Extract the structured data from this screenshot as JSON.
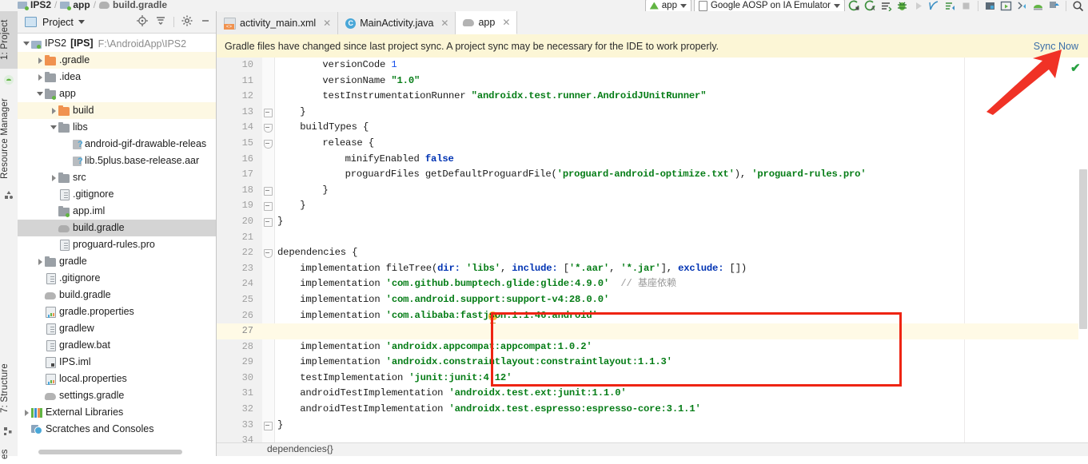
{
  "window": {
    "breadcrumb": [
      {
        "label": "IPS2",
        "icon": "module-icon",
        "type": "module"
      },
      {
        "label": "app",
        "icon": "module-icon",
        "type": "module"
      },
      {
        "label": "build.gradle",
        "icon": "gradle-icon",
        "type": "file"
      }
    ],
    "run_config": "app",
    "device": "Google AOSP on IA Emulator",
    "toolbar_icons": [
      "debug-step-icon",
      "debug-attach-icon",
      "logcat-icon",
      "bug-icon",
      "run-disabled-icon",
      "profiler-icon",
      "apply-changes-icon",
      "stop-icon",
      "avd-manager-icon",
      "run-button-icon",
      "sdk-sync-icon",
      "sdk-manager-icon",
      "download-icon",
      "search-icon"
    ]
  },
  "tool_strips": {
    "left": [
      {
        "label": "1: Project",
        "selected": true
      },
      {
        "label": "Resource Manager",
        "selected": false
      },
      {
        "label": "7: Structure",
        "selected": false
      },
      {
        "label": "es",
        "selected": false
      }
    ]
  },
  "project_panel": {
    "title": "Project",
    "tools": [
      "locate-icon",
      "collapse-all-icon",
      "settings-gear-icon",
      "hide-minimize-icon"
    ],
    "tree": [
      {
        "label": "IPS2",
        "tag": "[IPS]",
        "path": "F:\\AndroidApp\\IPS2",
        "indent": 0,
        "arrow": "open",
        "icon": "module-icon",
        "state": "normal"
      },
      {
        "label": ".gradle",
        "indent": 1,
        "arrow": "closed",
        "icon": "folder-orange-icon",
        "state": "highlight"
      },
      {
        "label": ".idea",
        "indent": 1,
        "arrow": "closed",
        "icon": "folder-gray-icon",
        "state": "normal"
      },
      {
        "label": "app",
        "indent": 1,
        "arrow": "open",
        "icon": "folder-module-icon",
        "state": "normal"
      },
      {
        "label": "build",
        "indent": 2,
        "arrow": "closed",
        "icon": "folder-orange-icon",
        "state": "highlight"
      },
      {
        "label": "libs",
        "indent": 2,
        "arrow": "open",
        "icon": "folder-gray-icon",
        "state": "normal"
      },
      {
        "label": "android-gif-drawable-releas",
        "indent": 3,
        "arrow": "none",
        "icon": "aar-file-icon",
        "state": "normal"
      },
      {
        "label": "lib.5plus.base-release.aar",
        "indent": 3,
        "arrow": "none",
        "icon": "aar-file-icon",
        "state": "normal"
      },
      {
        "label": "src",
        "indent": 2,
        "arrow": "closed",
        "icon": "folder-gray-icon",
        "state": "normal"
      },
      {
        "label": ".gitignore",
        "indent": 2,
        "arrow": "none",
        "icon": "text-file-icon",
        "state": "normal"
      },
      {
        "label": "app.iml",
        "indent": 2,
        "arrow": "none",
        "icon": "folder-module-icon",
        "state": "normal"
      },
      {
        "label": "build.gradle",
        "indent": 2,
        "arrow": "none",
        "icon": "gradle-file-icon",
        "state": "selected"
      },
      {
        "label": "proguard-rules.pro",
        "indent": 2,
        "arrow": "none",
        "icon": "text-file-icon",
        "state": "normal"
      },
      {
        "label": "gradle",
        "indent": 1,
        "arrow": "closed",
        "icon": "folder-gray-icon",
        "state": "normal"
      },
      {
        "label": ".gitignore",
        "indent": 1,
        "arrow": "none",
        "icon": "text-file-icon",
        "state": "normal"
      },
      {
        "label": "build.gradle",
        "indent": 1,
        "arrow": "none",
        "icon": "gradle-file-icon",
        "state": "normal"
      },
      {
        "label": "gradle.properties",
        "indent": 1,
        "arrow": "none",
        "icon": "properties-file-icon",
        "state": "normal"
      },
      {
        "label": "gradlew",
        "indent": 1,
        "arrow": "none",
        "icon": "text-file-icon",
        "state": "normal"
      },
      {
        "label": "gradlew.bat",
        "indent": 1,
        "arrow": "none",
        "icon": "text-file-icon",
        "state": "normal"
      },
      {
        "label": "IPS.iml",
        "indent": 1,
        "arrow": "none",
        "icon": "iml-file-icon",
        "state": "normal"
      },
      {
        "label": "local.properties",
        "indent": 1,
        "arrow": "none",
        "icon": "properties-file-icon",
        "state": "normal"
      },
      {
        "label": "settings.gradle",
        "indent": 1,
        "arrow": "none",
        "icon": "gradle-file-icon",
        "state": "normal"
      },
      {
        "label": "External Libraries",
        "indent": 0,
        "arrow": "closed",
        "icon": "external-libraries-icon",
        "state": "normal"
      },
      {
        "label": "Scratches and Consoles",
        "indent": 0,
        "arrow": "none",
        "icon": "scratches-icon",
        "state": "normal"
      }
    ]
  },
  "editor": {
    "tabs": [
      {
        "label": "activity_main.xml",
        "icon": "xml-layout-icon",
        "active": false,
        "closable": true
      },
      {
        "label": "MainActivity.java",
        "icon": "java-class-icon",
        "active": false,
        "closable": true
      },
      {
        "label": "app",
        "icon": "gradle-icon",
        "active": true,
        "closable": true
      }
    ],
    "banner": {
      "message": "Gradle files have changed since last project sync. A project sync may be necessary for the IDE to work properly.",
      "action": "Sync Now"
    },
    "caret_line": 27,
    "first_line": 10,
    "bottom_breadcrumb": "dependencies{}",
    "lines": [
      {
        "n": 10,
        "indent": 8,
        "tokens": [
          {
            "t": "versionCode ",
            "c": "fnd"
          },
          {
            "t": "1",
            "c": "num"
          }
        ]
      },
      {
        "n": 11,
        "indent": 8,
        "tokens": [
          {
            "t": "versionName ",
            "c": "fnd"
          },
          {
            "t": "\"1.0\"",
            "c": "str"
          }
        ]
      },
      {
        "n": 12,
        "indent": 8,
        "tokens": [
          {
            "t": "testInstrumentationRunner ",
            "c": "fnd"
          },
          {
            "t": "\"androidx.test.runner.AndroidJUnitRunner\"",
            "c": "str"
          }
        ]
      },
      {
        "n": 13,
        "indent": 4,
        "fold": "end",
        "tokens": [
          {
            "t": "}",
            "c": "fnd"
          }
        ]
      },
      {
        "n": 14,
        "indent": 4,
        "fold": "tip",
        "tokens": [
          {
            "t": "buildTypes {",
            "c": "fnd"
          }
        ]
      },
      {
        "n": 15,
        "indent": 8,
        "fold": "tip",
        "tokens": [
          {
            "t": "release {",
            "c": "fnd"
          }
        ]
      },
      {
        "n": 16,
        "indent": 12,
        "tokens": [
          {
            "t": "minifyEnabled ",
            "c": "fnd"
          },
          {
            "t": "false",
            "c": "kw"
          }
        ]
      },
      {
        "n": 17,
        "indent": 12,
        "tokens": [
          {
            "t": "proguardFiles getDefaultProguardFile(",
            "c": "fnd"
          },
          {
            "t": "'proguard-android-optimize.txt'",
            "c": "str"
          },
          {
            "t": "), ",
            "c": "fnd"
          },
          {
            "t": "'proguard-rules.pro'",
            "c": "str"
          }
        ]
      },
      {
        "n": 18,
        "indent": 8,
        "fold": "end",
        "tokens": [
          {
            "t": "}",
            "c": "fnd"
          }
        ]
      },
      {
        "n": 19,
        "indent": 4,
        "fold": "end",
        "tokens": [
          {
            "t": "}",
            "c": "fnd"
          }
        ]
      },
      {
        "n": 20,
        "indent": 0,
        "fold": "end",
        "tokens": [
          {
            "t": "}",
            "c": "fnd"
          }
        ]
      },
      {
        "n": 21,
        "indent": 0,
        "tokens": []
      },
      {
        "n": 22,
        "indent": 0,
        "fold": "tip",
        "tokens": [
          {
            "t": "dependencies {",
            "c": "fnd"
          }
        ]
      },
      {
        "n": 23,
        "indent": 4,
        "boxed": true,
        "tokens": [
          {
            "t": "implementation fileTree(",
            "c": "fnd"
          },
          {
            "t": "dir: ",
            "c": "kw"
          },
          {
            "t": "'libs'",
            "c": "str"
          },
          {
            "t": ", ",
            "c": "fnd"
          },
          {
            "t": "include: ",
            "c": "kw"
          },
          {
            "t": "[",
            "c": "fnd"
          },
          {
            "t": "'*.aar'",
            "c": "str"
          },
          {
            "t": ", ",
            "c": "fnd"
          },
          {
            "t": "'*.jar'",
            "c": "str"
          },
          {
            "t": "], ",
            "c": "fnd"
          },
          {
            "t": "exclude: ",
            "c": "kw"
          },
          {
            "t": "[])",
            "c": "fnd"
          }
        ]
      },
      {
        "n": 24,
        "indent": 4,
        "boxed": true,
        "tokens": [
          {
            "t": "implementation ",
            "c": "fnd"
          },
          {
            "t": "'com.github.bumptech.glide:glide:4.9.0'",
            "c": "str"
          },
          {
            "t": "  // 基座依赖",
            "c": "cmt"
          }
        ]
      },
      {
        "n": 25,
        "indent": 4,
        "boxed": true,
        "tokens": [
          {
            "t": "implementation ",
            "c": "fnd"
          },
          {
            "t": "'com.android.support:support-v4:28.0.0'",
            "c": "str"
          }
        ]
      },
      {
        "n": 26,
        "indent": 4,
        "boxed": true,
        "bulb": true,
        "tokens": [
          {
            "t": "implementation ",
            "c": "fnd"
          },
          {
            "t": "'com.alibaba:fastjson:1.1.46.android'",
            "c": "str"
          }
        ]
      },
      {
        "n": 27,
        "indent": 0,
        "caret": true,
        "tokens": []
      },
      {
        "n": 28,
        "indent": 4,
        "tokens": [
          {
            "t": "implementation ",
            "c": "fnd"
          },
          {
            "t": "'androidx.appcompat:appcompat:1.0.2'",
            "c": "str"
          }
        ]
      },
      {
        "n": 29,
        "indent": 4,
        "tokens": [
          {
            "t": "implementation ",
            "c": "fnd"
          },
          {
            "t": "'androidx.constraintlayout:constraintlayout:1.1.3'",
            "c": "str"
          }
        ]
      },
      {
        "n": 30,
        "indent": 4,
        "tokens": [
          {
            "t": "testImplementation ",
            "c": "fnd"
          },
          {
            "t": "'junit:junit:4.12'",
            "c": "str"
          }
        ]
      },
      {
        "n": 31,
        "indent": 4,
        "tokens": [
          {
            "t": "androidTestImplementation ",
            "c": "fnd"
          },
          {
            "t": "'androidx.test.ext:junit:1.1.0'",
            "c": "str"
          }
        ]
      },
      {
        "n": 32,
        "indent": 4,
        "tokens": [
          {
            "t": "androidTestImplementation ",
            "c": "fnd"
          },
          {
            "t": "'androidx.test.espresso:espresso-core:3.1.1'",
            "c": "str"
          }
        ]
      },
      {
        "n": 33,
        "indent": 0,
        "fold": "end",
        "tokens": [
          {
            "t": "}",
            "c": "fnd"
          }
        ]
      },
      {
        "n": 34,
        "indent": 0,
        "tokens": []
      }
    ],
    "annotations": {
      "red_box_color": "#ee2413",
      "arrow_color": "#f03226",
      "inspection_status": "ok-checkmark"
    }
  },
  "colors": {
    "banner_bg": "#fcf6d6",
    "link": "#3b6ea8",
    "string": "#067d17",
    "keyword": "#0033b3",
    "comment": "#9a9a9a",
    "caret_row": "#fffae6",
    "tree_highlight": "#fdf8e3",
    "tree_selected": "#d4d4d4"
  }
}
